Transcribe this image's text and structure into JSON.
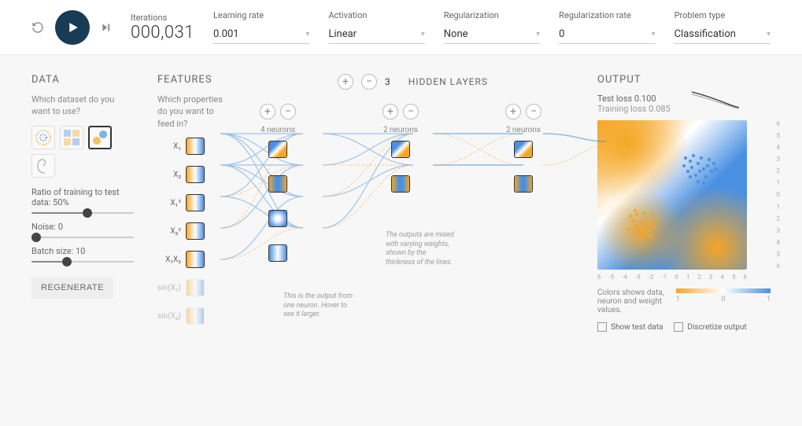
{
  "top": {
    "iterations_label": "Iterations",
    "iterations_value": "000,031",
    "selects": {
      "learning_rate": {
        "label": "Learning rate",
        "value": "0.001"
      },
      "activation": {
        "label": "Activation",
        "value": "Linear"
      },
      "regularization": {
        "label": "Regularization",
        "value": "None"
      },
      "reg_rate": {
        "label": "Regularization rate",
        "value": "0"
      },
      "problem": {
        "label": "Problem type",
        "value": "Classification"
      }
    }
  },
  "data": {
    "title": "DATA",
    "sub": "Which dataset do you want to use?",
    "ratio_label": "Ratio of training to test data:",
    "ratio_value": "50%",
    "noise_label": "Noise:",
    "noise_value": "0",
    "batch_label": "Batch size:",
    "batch_value": "10",
    "regenerate": "REGENERATE"
  },
  "features": {
    "title": "FEATURES",
    "sub": "Which properties do you want to feed in?",
    "items": [
      "X₁",
      "X₂",
      "X₁²",
      "X₂²",
      "X₁X₂",
      "sin(X₁)",
      "sin(X₂)"
    ]
  },
  "hidden": {
    "count": "3",
    "title": "HIDDEN LAYERS",
    "layers": [
      {
        "neurons": "4 neurons"
      },
      {
        "neurons": "2 neurons"
      },
      {
        "neurons": "2 neurons"
      }
    ],
    "annot_mix": "The outputs are mixed with varying weights, shown by the thickness of the lines.",
    "annot_neuron": "This is the output from one neuron. Hover to see it larger."
  },
  "output": {
    "title": "OUTPUT",
    "test_loss_label": "Test loss",
    "test_loss_value": "0.100",
    "train_loss_label": "Training loss",
    "train_loss_value": "0.085",
    "y_ticks": [
      "6",
      "5",
      "4",
      "3",
      "2",
      "1",
      "0",
      "1",
      "2",
      "3",
      "4",
      "5",
      "6"
    ],
    "x_ticks": [
      "6",
      "-5",
      "-4",
      "-3",
      "-2",
      "-1",
      "0",
      "1",
      "2",
      "3",
      "4",
      "5",
      "6"
    ],
    "legend_text": "Colors shows data, neuron and weight values.",
    "legend_neg": "1",
    "legend_zero": "0",
    "legend_pos": "1",
    "show_test": "Show test data",
    "discretize": "Discretize output"
  }
}
